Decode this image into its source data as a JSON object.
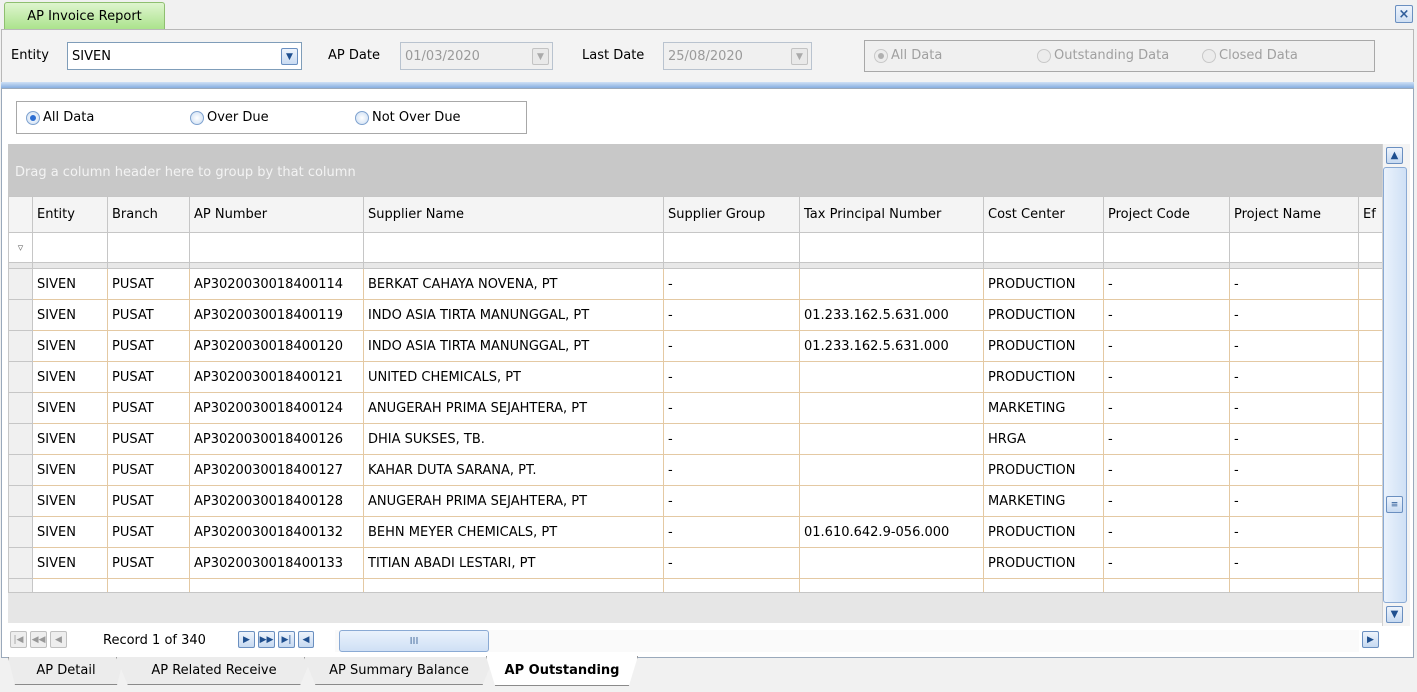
{
  "window": {
    "tab_title": "AP Invoice Report",
    "close_glyph": "×"
  },
  "filters": {
    "entity_label": "Entity",
    "entity_value": "SIVEN",
    "ap_date_label": "AP Date",
    "ap_date_value": "01/03/2020",
    "last_date_label": "Last Date",
    "last_date_value": "25/08/2020",
    "data_options": [
      {
        "label": "All Data",
        "selected": true
      },
      {
        "label": "Outstanding Data",
        "selected": false
      },
      {
        "label": "Closed Data",
        "selected": false
      }
    ]
  },
  "due_filter": {
    "options": [
      {
        "label": "All Data",
        "selected": true
      },
      {
        "label": "Over Due",
        "selected": false
      },
      {
        "label": "Not Over Due",
        "selected": false
      }
    ]
  },
  "grid": {
    "group_hint": "Drag a column header here to group by that column",
    "columns": [
      "Entity",
      "Branch",
      "AP Number",
      "Supplier Name",
      "Supplier Group",
      "Tax Principal Number",
      "Cost Center",
      "Project Code",
      "Project Name",
      "Ef"
    ],
    "rows": [
      [
        "SIVEN",
        "PUSAT",
        "AP3020030018400114",
        "BERKAT CAHAYA NOVENA, PT",
        "-",
        "",
        "PRODUCTION",
        "-",
        "-",
        ""
      ],
      [
        "SIVEN",
        "PUSAT",
        "AP3020030018400119",
        "INDO ASIA TIRTA MANUNGGAL, PT",
        "-",
        "01.233.162.5.631.000",
        "PRODUCTION",
        "-",
        "-",
        ""
      ],
      [
        "SIVEN",
        "PUSAT",
        "AP3020030018400120",
        "INDO ASIA TIRTA MANUNGGAL, PT",
        "-",
        "01.233.162.5.631.000",
        "PRODUCTION",
        "-",
        "-",
        ""
      ],
      [
        "SIVEN",
        "PUSAT",
        "AP3020030018400121",
        "UNITED CHEMICALS, PT",
        "-",
        "",
        "PRODUCTION",
        "-",
        "-",
        ""
      ],
      [
        "SIVEN",
        "PUSAT",
        "AP3020030018400124",
        "ANUGERAH PRIMA SEJAHTERA, PT",
        "-",
        "",
        "MARKETING",
        "-",
        "-",
        ""
      ],
      [
        "SIVEN",
        "PUSAT",
        "AP3020030018400126",
        "DHIA SUKSES, TB.",
        "-",
        "",
        "HRGA",
        "-",
        "-",
        ""
      ],
      [
        "SIVEN",
        "PUSAT",
        "AP3020030018400127",
        "KAHAR DUTA SARANA, PT.",
        "-",
        "",
        "PRODUCTION",
        "-",
        "-",
        ""
      ],
      [
        "SIVEN",
        "PUSAT",
        "AP3020030018400128",
        "ANUGERAH PRIMA SEJAHTERA, PT",
        "-",
        "",
        "MARKETING",
        "-",
        "-",
        ""
      ],
      [
        "SIVEN",
        "PUSAT",
        "AP3020030018400132",
        "BEHN MEYER CHEMICALS, PT",
        "-",
        "01.610.642.9-056.000",
        "PRODUCTION",
        "-",
        "-",
        ""
      ],
      [
        "SIVEN",
        "PUSAT",
        "AP3020030018400133",
        "TITIAN ABADI LESTARI, PT",
        "-",
        "",
        "PRODUCTION",
        "-",
        "-",
        ""
      ]
    ]
  },
  "navigator": {
    "record_text": "Record 1 of 340",
    "thumb_glyph": "III"
  },
  "bottom_tabs": [
    {
      "label": "AP Detail",
      "active": false
    },
    {
      "label": "AP Related Receive",
      "active": false
    },
    {
      "label": "AP Summary Balance",
      "active": false
    },
    {
      "label": "AP Outstanding",
      "active": true
    }
  ],
  "icons": {
    "dropdown": "chevron-down-icon",
    "filter": "filter-icon",
    "scroll_up": "arrow-up-icon",
    "scroll_down": "arrow-down-icon",
    "first": "first-record-icon",
    "prev_page": "previous-page-icon",
    "prev": "previous-record-icon",
    "next": "next-record-icon",
    "next_page": "next-page-icon",
    "last": "last-record-icon"
  },
  "colors": {
    "tab_green": "#a9e28a",
    "accent_blue": "#2c6ed2",
    "row_border": "#e4c9a3"
  }
}
